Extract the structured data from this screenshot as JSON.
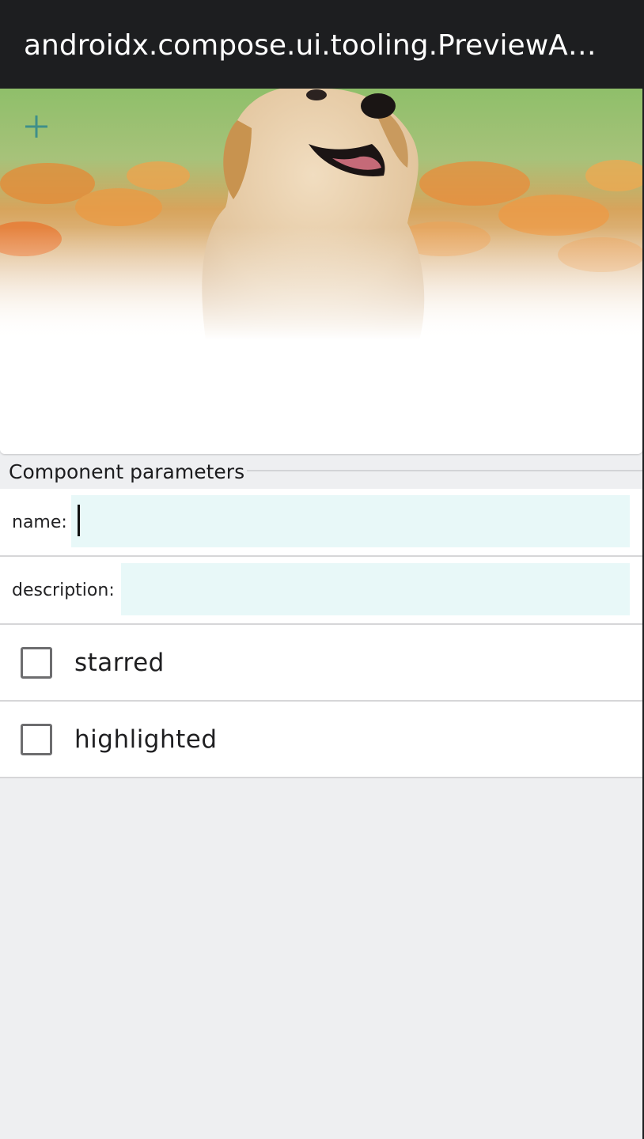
{
  "appbar": {
    "title": "androidx.compose.ui.tooling.PreviewA…"
  },
  "preview": {
    "add_icon": "plus-icon",
    "image": "puppy-photo",
    "accent_color": "#3f8f8a"
  },
  "params": {
    "section_title": "Component parameters",
    "name": {
      "label": "name:",
      "value": "",
      "placeholder": ""
    },
    "description": {
      "label": "description:",
      "value": "",
      "placeholder": ""
    },
    "starred": {
      "label": "starred",
      "checked": false
    },
    "highlighted": {
      "label": "highlighted",
      "checked": false
    }
  },
  "colors": {
    "appbar": "#1d1e20",
    "input_background": "#e8f8f8",
    "page_background": "#eeeff1"
  }
}
